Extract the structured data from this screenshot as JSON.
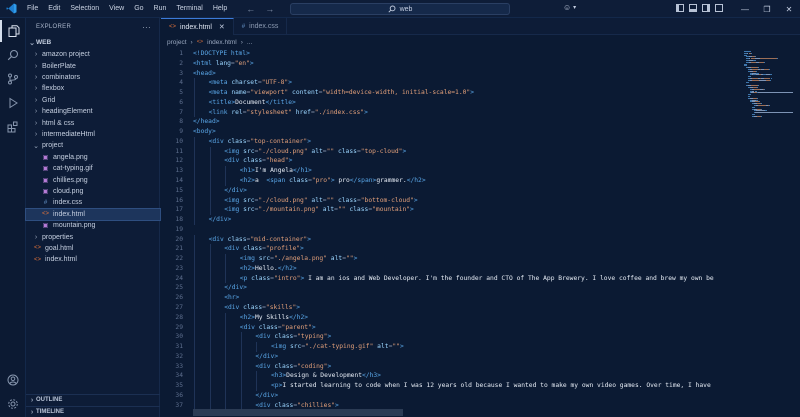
{
  "menu": [
    "File",
    "Edit",
    "Selection",
    "View",
    "Go",
    "Run",
    "Terminal",
    "Help"
  ],
  "search": {
    "text": "web"
  },
  "sidebar": {
    "title": "EXPLORER",
    "root": "WEB",
    "items": [
      {
        "label": "amazon project",
        "kind": "folder"
      },
      {
        "label": "BoilerPlate",
        "kind": "folder"
      },
      {
        "label": "combinators",
        "kind": "folder"
      },
      {
        "label": "flexbox",
        "kind": "folder"
      },
      {
        "label": "Grid",
        "kind": "folder"
      },
      {
        "label": "headingElement",
        "kind": "folder"
      },
      {
        "label": "html & css",
        "kind": "folder"
      },
      {
        "label": "intermediateHtml",
        "kind": "folder"
      },
      {
        "label": "project",
        "kind": "folder-open"
      },
      {
        "label": "angela.png",
        "kind": "image"
      },
      {
        "label": "cat-typing.gif",
        "kind": "image"
      },
      {
        "label": "chillies.png",
        "kind": "image"
      },
      {
        "label": "cloud.png",
        "kind": "image"
      },
      {
        "label": "index.css",
        "kind": "css"
      },
      {
        "label": "index.html",
        "kind": "html",
        "selected": true
      },
      {
        "label": "mountain.png",
        "kind": "image"
      },
      {
        "label": "properties",
        "kind": "folder"
      },
      {
        "label": "goal.html",
        "kind": "html"
      },
      {
        "label": "index.html",
        "kind": "html"
      }
    ],
    "sections": [
      "OUTLINE",
      "TIMELINE"
    ]
  },
  "tabs": [
    {
      "label": "index.html",
      "icon": "html-icon",
      "active": true
    },
    {
      "label": "index.css",
      "icon": "css-icon",
      "active": false
    }
  ],
  "breadcrumb": [
    "project",
    "index.html",
    "..."
  ],
  "code": {
    "first_line": 1,
    "lines": [
      [
        0,
        [
          [
            "tag",
            "<!DOCTYPE html>"
          ]
        ]
      ],
      [
        0,
        [
          [
            "tag",
            "<html "
          ],
          [
            "attr",
            "lang"
          ],
          [
            "punc",
            "="
          ],
          [
            "val",
            "\"en\""
          ],
          [
            "tag",
            ">"
          ]
        ]
      ],
      [
        0,
        [
          [
            "tag",
            "<head>"
          ]
        ]
      ],
      [
        1,
        [
          [
            "tag",
            "<meta "
          ],
          [
            "attr",
            "charset"
          ],
          [
            "punc",
            "="
          ],
          [
            "val",
            "\"UTF-8\""
          ],
          [
            "tag",
            ">"
          ]
        ]
      ],
      [
        1,
        [
          [
            "tag",
            "<meta "
          ],
          [
            "attr",
            "name"
          ],
          [
            "punc",
            "="
          ],
          [
            "val",
            "\"viewport\""
          ],
          [
            "attr",
            " content"
          ],
          [
            "punc",
            "="
          ],
          [
            "val",
            "\"width=device-width, initial-scale=1.0\""
          ],
          [
            "tag",
            ">"
          ]
        ]
      ],
      [
        1,
        [
          [
            "tag",
            "<title>"
          ],
          [
            "txt",
            "Document"
          ],
          [
            "tag",
            "</title>"
          ]
        ]
      ],
      [
        1,
        [
          [
            "tag",
            "<link "
          ],
          [
            "attr",
            "rel"
          ],
          [
            "punc",
            "="
          ],
          [
            "val",
            "\"stylesheet\""
          ],
          [
            "attr",
            " href"
          ],
          [
            "punc",
            "="
          ],
          [
            "val",
            "\"./index.css\""
          ],
          [
            "tag",
            ">"
          ]
        ]
      ],
      [
        0,
        [
          [
            "tag",
            "</head>"
          ]
        ]
      ],
      [
        0,
        [
          [
            "tag",
            "<body>"
          ]
        ]
      ],
      [
        1,
        [
          [
            "tag",
            "<div "
          ],
          [
            "attr",
            "class"
          ],
          [
            "punc",
            "="
          ],
          [
            "val",
            "\"top-container\""
          ],
          [
            "tag",
            ">"
          ]
        ]
      ],
      [
        2,
        [
          [
            "tag",
            "<img "
          ],
          [
            "attr",
            "src"
          ],
          [
            "punc",
            "="
          ],
          [
            "val",
            "\"./cloud.png\""
          ],
          [
            "attr",
            " alt"
          ],
          [
            "punc",
            "="
          ],
          [
            "val",
            "\"\""
          ],
          [
            "attr",
            " class"
          ],
          [
            "punc",
            "="
          ],
          [
            "val",
            "\"top-cloud\""
          ],
          [
            "tag",
            ">"
          ]
        ]
      ],
      [
        2,
        [
          [
            "tag",
            "<div "
          ],
          [
            "attr",
            "class"
          ],
          [
            "punc",
            "="
          ],
          [
            "val",
            "\"head\""
          ],
          [
            "tag",
            ">"
          ]
        ]
      ],
      [
        3,
        [
          [
            "tag",
            "<h1>"
          ],
          [
            "txt",
            "I'm Angela"
          ],
          [
            "tag",
            "</h1>"
          ]
        ]
      ],
      [
        3,
        [
          [
            "tag",
            "<h2>"
          ],
          [
            "txt",
            "a  "
          ],
          [
            "tag",
            "<span "
          ],
          [
            "attr",
            "class"
          ],
          [
            "punc",
            "="
          ],
          [
            "val",
            "\"pro\""
          ],
          [
            "tag",
            ">"
          ],
          [
            "txt",
            " pro"
          ],
          [
            "tag",
            "</span>"
          ],
          [
            "txt",
            "grammer."
          ],
          [
            "tag",
            "</h2>"
          ]
        ]
      ],
      [
        2,
        [
          [
            "tag",
            "</div>"
          ]
        ]
      ],
      [
        2,
        [
          [
            "tag",
            "<img "
          ],
          [
            "attr",
            "src"
          ],
          [
            "punc",
            "="
          ],
          [
            "val",
            "\"./cloud.png\""
          ],
          [
            "attr",
            " alt"
          ],
          [
            "punc",
            "="
          ],
          [
            "val",
            "\"\""
          ],
          [
            "attr",
            " class"
          ],
          [
            "punc",
            "="
          ],
          [
            "val",
            "\"bottom-cloud\""
          ],
          [
            "tag",
            ">"
          ]
        ]
      ],
      [
        2,
        [
          [
            "tag",
            "<img "
          ],
          [
            "attr",
            "src"
          ],
          [
            "punc",
            "="
          ],
          [
            "val",
            "\"./mountain.png\""
          ],
          [
            "attr",
            " alt"
          ],
          [
            "punc",
            "="
          ],
          [
            "val",
            "\"\""
          ],
          [
            "attr",
            " class"
          ],
          [
            "punc",
            "="
          ],
          [
            "val",
            "\"mountain\""
          ],
          [
            "tag",
            ">"
          ]
        ]
      ],
      [
        1,
        [
          [
            "tag",
            "</div>"
          ]
        ]
      ],
      [
        0,
        []
      ],
      [
        1,
        [
          [
            "tag",
            "<div "
          ],
          [
            "attr",
            "class"
          ],
          [
            "punc",
            "="
          ],
          [
            "val",
            "\"mid-container\""
          ],
          [
            "tag",
            ">"
          ]
        ]
      ],
      [
        2,
        [
          [
            "tag",
            "<div "
          ],
          [
            "attr",
            "class"
          ],
          [
            "punc",
            "="
          ],
          [
            "val",
            "\"profile\""
          ],
          [
            "tag",
            ">"
          ]
        ]
      ],
      [
        3,
        [
          [
            "tag",
            "<img "
          ],
          [
            "attr",
            "src"
          ],
          [
            "punc",
            "="
          ],
          [
            "val",
            "\"./angela.png\""
          ],
          [
            "attr",
            " alt"
          ],
          [
            "punc",
            "="
          ],
          [
            "val",
            "\"\""
          ],
          [
            "tag",
            ">"
          ]
        ]
      ],
      [
        3,
        [
          [
            "tag",
            "<h2>"
          ],
          [
            "txt",
            "Hello."
          ],
          [
            "tag",
            "</h2>"
          ]
        ]
      ],
      [
        3,
        [
          [
            "tag",
            "<p "
          ],
          [
            "attr",
            "class"
          ],
          [
            "punc",
            "="
          ],
          [
            "val",
            "\"intro\""
          ],
          [
            "tag",
            ">"
          ],
          [
            "txt",
            " I am an ios and Web Developer. I'm the founder and CTO of The App Brewery. I love coffee and brew my own be"
          ]
        ]
      ],
      [
        2,
        [
          [
            "tag",
            "</div>"
          ]
        ]
      ],
      [
        2,
        [
          [
            "tag",
            "<hr>"
          ]
        ]
      ],
      [
        2,
        [
          [
            "tag",
            "<div "
          ],
          [
            "attr",
            "class"
          ],
          [
            "punc",
            "="
          ],
          [
            "val",
            "\"skills\""
          ],
          [
            "tag",
            ">"
          ]
        ]
      ],
      [
        3,
        [
          [
            "tag",
            "<h2>"
          ],
          [
            "txt",
            "My Skills"
          ],
          [
            "tag",
            "</h2>"
          ]
        ]
      ],
      [
        3,
        [
          [
            "tag",
            "<div "
          ],
          [
            "attr",
            "class"
          ],
          [
            "punc",
            "="
          ],
          [
            "val",
            "\"parent\""
          ],
          [
            "tag",
            ">"
          ]
        ]
      ],
      [
        4,
        [
          [
            "tag",
            "<div "
          ],
          [
            "attr",
            "class"
          ],
          [
            "punc",
            "="
          ],
          [
            "val",
            "\"typing\""
          ],
          [
            "tag",
            ">"
          ]
        ]
      ],
      [
        5,
        [
          [
            "tag",
            "<img "
          ],
          [
            "attr",
            "src"
          ],
          [
            "punc",
            "="
          ],
          [
            "val",
            "\"./cat-typing.gif\""
          ],
          [
            "attr",
            " alt"
          ],
          [
            "punc",
            "="
          ],
          [
            "val",
            "\"\""
          ],
          [
            "tag",
            ">"
          ]
        ]
      ],
      [
        4,
        [
          [
            "tag",
            "</div>"
          ]
        ]
      ],
      [
        4,
        [
          [
            "tag",
            "<div "
          ],
          [
            "attr",
            "class"
          ],
          [
            "punc",
            "="
          ],
          [
            "val",
            "\"coding\""
          ],
          [
            "tag",
            ">"
          ]
        ]
      ],
      [
        5,
        [
          [
            "tag",
            "<h3>"
          ],
          [
            "txt",
            "Design & Development"
          ],
          [
            "tag",
            "</h3>"
          ]
        ]
      ],
      [
        5,
        [
          [
            "tag",
            "<p>"
          ],
          [
            "txt",
            "I started learning to code when I was 12 years old because I wanted to make my own video games. Over time, I have"
          ]
        ]
      ],
      [
        4,
        [
          [
            "tag",
            "</div>"
          ]
        ]
      ],
      [
        4,
        [
          [
            "tag",
            "<div "
          ],
          [
            "attr",
            "class"
          ],
          [
            "punc",
            "="
          ],
          [
            "val",
            "\"chillies\""
          ],
          [
            "tag",
            ">"
          ]
        ]
      ]
    ]
  },
  "colors": {
    "bg": "#0b1a33",
    "sidebar": "#0d1c37",
    "tag": "#5aa7e8",
    "attr": "#9cd6ff",
    "value": "#e3a07a",
    "text": "#e6ecf5",
    "accent": "#3c7ad9"
  }
}
